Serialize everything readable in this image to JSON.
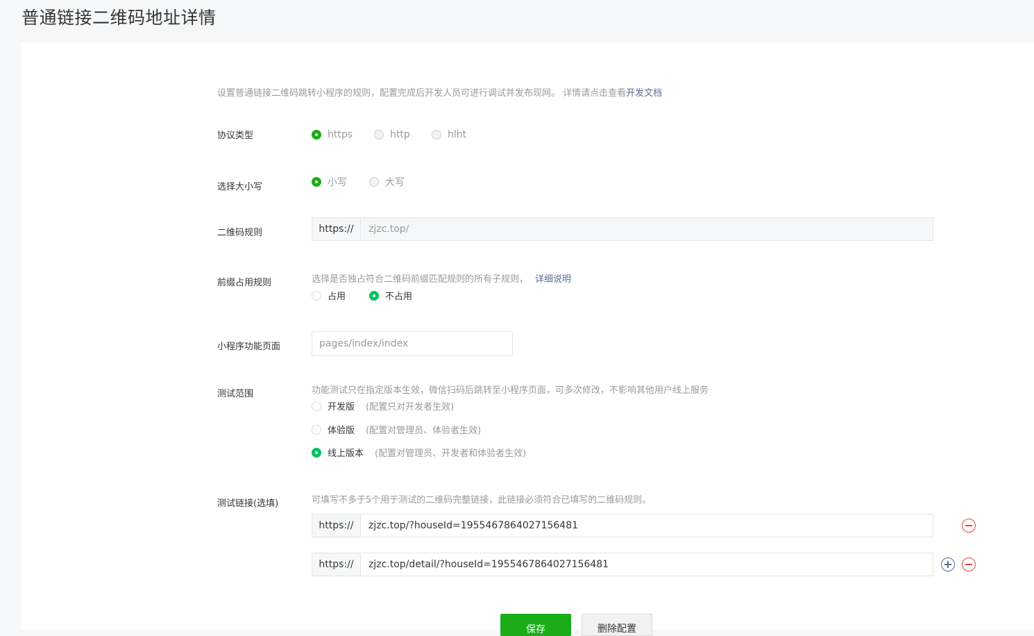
{
  "page_title": "普通链接二维码地址详情",
  "intro": {
    "text": "设置普通链接二维码跳转小程序的规则，配置完成后开发人员可进行调试并发布现网。 详情请点击查看",
    "link": "开发文档"
  },
  "protocol": {
    "label": "协议类型",
    "options": [
      "https",
      "http",
      "hlht"
    ],
    "selected": "https"
  },
  "case": {
    "label": "选择大小写",
    "options": [
      "小写",
      "大写"
    ],
    "selected": "小写"
  },
  "qr_rule": {
    "label": "二维码规则",
    "prefix": "https://",
    "value": "zjzc.top/"
  },
  "prefix_rule": {
    "label": "前缀占用规则",
    "hint": "选择是否独占符合二维码前缀匹配规则的所有子规则，",
    "hint_link": "详细说明",
    "options": [
      "占用",
      "不占用"
    ],
    "selected": "不占用"
  },
  "mp_page": {
    "label": "小程序功能页面",
    "placeholder": "pages/index/index"
  },
  "test_scope": {
    "label": "测试范围",
    "hint": "功能测试只在指定版本生效，微信扫码后跳转至小程序页面，可多次修改，不影响其他用户线上服务",
    "options": [
      {
        "label": "开发版",
        "note": "(配置只对开发者生效)"
      },
      {
        "label": "体验版",
        "note": "(配置对管理员、体验者生效)"
      },
      {
        "label": "线上版本",
        "note": "(配置对管理员、开发者和体验者生效)"
      }
    ],
    "selected": "线上版本"
  },
  "test_links": {
    "label": "测试链接(选填)",
    "hint": "可填写不多于5个用于测试的二维码完整链接，此链接必须符合已填写的二维码规则。",
    "items": [
      {
        "prefix": "https://",
        "value": "zjzc.top/?houseId=1955467864027156481"
      },
      {
        "prefix": "https://",
        "value": "zjzc.top/detail/?houseId=1955467864027156481"
      }
    ]
  },
  "actions": {
    "save": "保存",
    "delete": "删除配置"
  },
  "colors": {
    "primary_green": "#1aad19",
    "link_blue": "#576b95",
    "danger_red": "#e64340"
  }
}
